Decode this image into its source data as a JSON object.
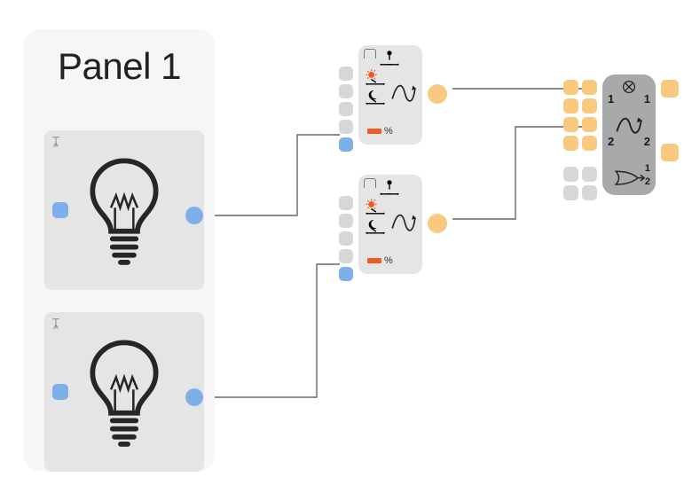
{
  "panel": {
    "title": "Panel 1"
  },
  "controller": {
    "percent_suffix": "%"
  },
  "output": {
    "num_top_left": "1",
    "num_top_right": "1",
    "num_mid_left": "2",
    "num_mid_right": "2",
    "num_gate_top": "1",
    "num_gate_bot": "2"
  },
  "colors": {
    "panel_bg": "#f6f6f6",
    "block_bg": "#e6e5e5",
    "port_blue": "#7db0e8",
    "port_gray": "#d7d7d7",
    "port_orange": "#f8c97f",
    "accent_red": "#f15a24",
    "out_bg": "#a9a9a9"
  }
}
